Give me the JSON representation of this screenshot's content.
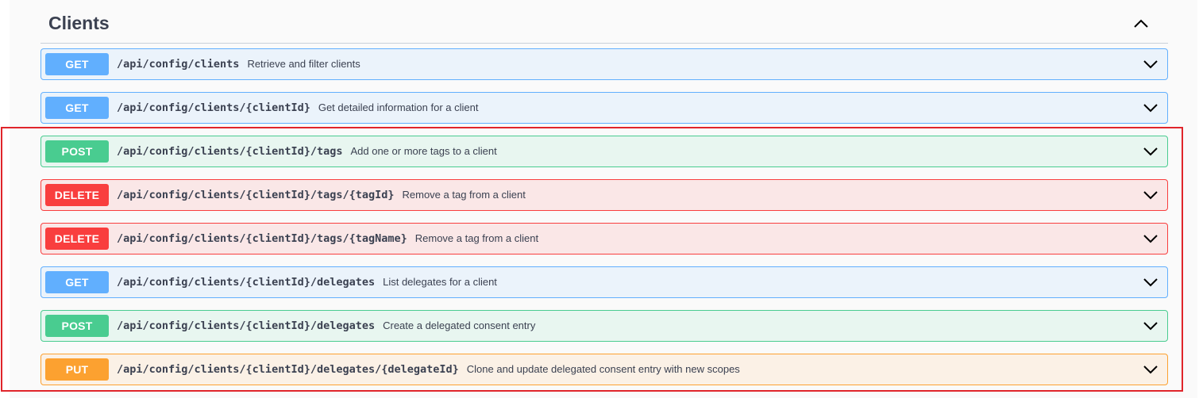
{
  "section": {
    "title": "Clients",
    "toggle_icon": "chevron-up-icon"
  },
  "colors": {
    "get": "#61affe",
    "post": "#49cc90",
    "delete": "#f93e3e",
    "put": "#fca130",
    "highlight": "#e0252b"
  },
  "operations": [
    {
      "method": "GET",
      "path": "/api/config/clients",
      "summary": "Retrieve and filter clients"
    },
    {
      "method": "GET",
      "path": "/api/config/clients/{clientId}",
      "summary": "Get detailed information for a client"
    },
    {
      "method": "POST",
      "path": "/api/config/clients/{clientId}/tags",
      "summary": "Add one or more tags to a client"
    },
    {
      "method": "DELETE",
      "path": "/api/config/clients/{clientId}/tags/{tagId}",
      "summary": "Remove a tag from a client"
    },
    {
      "method": "DELETE",
      "path": "/api/config/clients/{clientId}/tags/{tagName}",
      "summary": "Remove a tag from a client"
    },
    {
      "method": "GET",
      "path": "/api/config/clients/{clientId}/delegates",
      "summary": "List delegates for a client"
    },
    {
      "method": "POST",
      "path": "/api/config/clients/{clientId}/delegates",
      "summary": "Create a delegated consent entry"
    },
    {
      "method": "PUT",
      "path": "/api/config/clients/{clientId}/delegates/{delegateId}",
      "summary": "Clone and update delegated consent entry with new scopes"
    }
  ]
}
